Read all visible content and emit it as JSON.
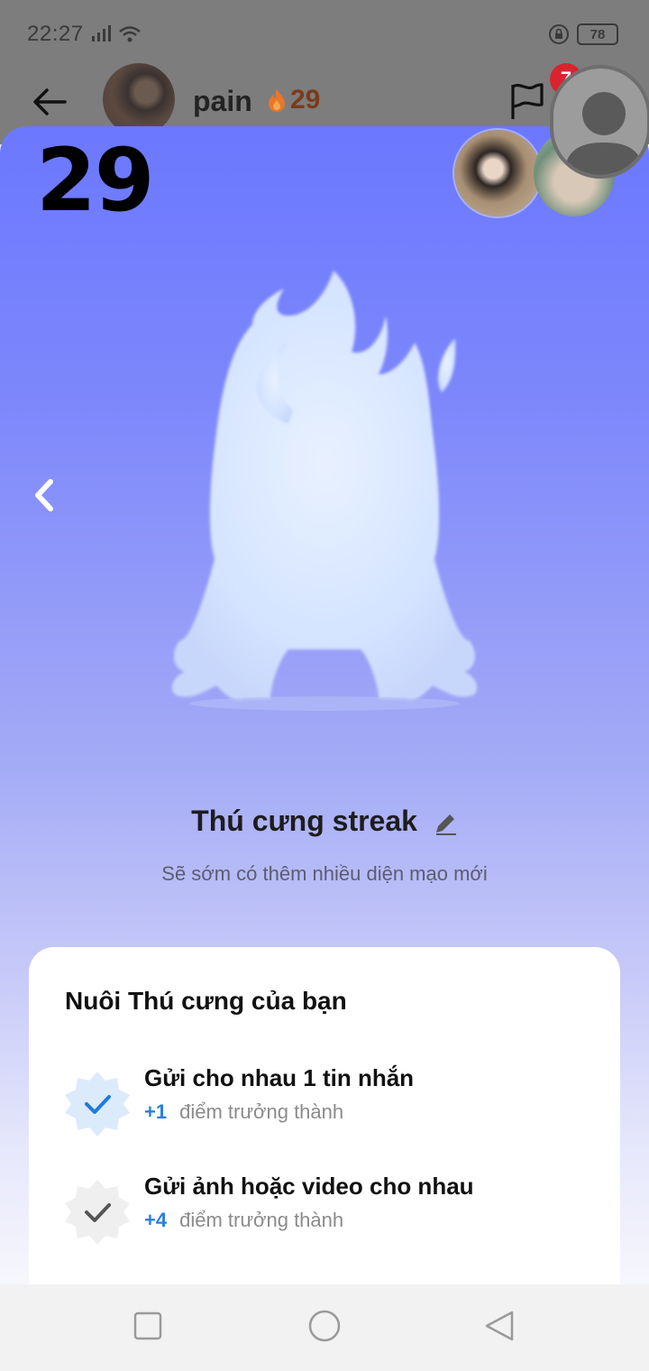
{
  "status_bar": {
    "time": "22:27",
    "battery": "78"
  },
  "header": {
    "name": "pain",
    "streak": "29",
    "notification_count": "7"
  },
  "streak_count": "29",
  "pet": {
    "name": "Thú cưng streak",
    "subtitle": "Sẽ sớm có thêm nhiều diện mạo mới"
  },
  "card": {
    "title": "Nuôi Thú cưng của bạn",
    "tasks": [
      {
        "title": "Gửi cho nhau 1 tin nhắn",
        "points": "+1",
        "suffix": "điểm trưởng thành",
        "completed": true
      },
      {
        "title": "Gửi ảnh hoặc video cho nhau",
        "points": "+4",
        "suffix": "điểm trưởng thành",
        "completed": false
      }
    ]
  },
  "icons": {
    "back": "arrow-left-icon",
    "flag": "flag-icon",
    "fire": "fire-icon",
    "edit": "pencil-icon",
    "prev": "chevron-left-icon",
    "nav": [
      "square-icon",
      "circle-icon",
      "triangle-left-icon"
    ]
  },
  "colors": {
    "sheet_top": "#6b78ff",
    "accent_blue": "#2b7de3",
    "badge_red": "#d9232f",
    "streak_orange": "#f07a1a"
  }
}
